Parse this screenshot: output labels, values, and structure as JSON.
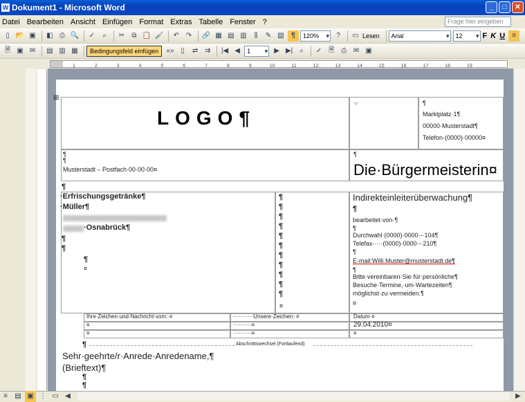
{
  "window": {
    "title": "Dokument1 - Microsoft Word",
    "help_placeholder": "Frage hier eingeben"
  },
  "menu": [
    "Datei",
    "Bearbeiten",
    "Ansicht",
    "Einfügen",
    "Format",
    "Extras",
    "Tabelle",
    "Fenster",
    "?"
  ],
  "toolbar": {
    "zoom": "120%",
    "read_label": "Lesen",
    "font": "Arial",
    "size": "12",
    "bold": "F",
    "italic": "K",
    "underline": "U",
    "insert_field_label": "Bedingungsfeld einfügen",
    "record_number": "1"
  },
  "ruler": {
    "ticks": [
      "1",
      "2",
      "3",
      "4",
      "5",
      "6",
      "7",
      "8",
      "9",
      "10",
      "11",
      "12",
      "13",
      "14",
      "15",
      "16",
      "17",
      "18",
      "19"
    ]
  },
  "letter": {
    "logo": "LOGO¶",
    "address": [
      "Marktplatz·1¶",
      "00000·Musterstadt¶",
      "Telefon·(0000)·00000¤"
    ],
    "sender_line": "Musterstadt –  Postfach·00·00·00¤",
    "authority": "Die·Bürgermeisterin¤",
    "recipient": [
      "·Erfrischungsgetränke¶",
      "·Müller¶",
      "·Osnabrück¶"
    ],
    "dept_title": "Indirekteinleiterüberwachung¶",
    "processed_by": "bearbeitet·von·¶",
    "phone_ext": "Durchwahl·(0000)·0000·-·104¶",
    "fax": "Telefax·····(0000)·0000·-·210¶",
    "email": "E-mail:Willi.Muster@musterstadt.de¶",
    "appointment": [
      "Bitte·vereinbaren·Sie·für·persönliche¶",
      "Besuche·Termine,·um·Wartezeiten¶",
      "möglichst·zu·vermeiden.¶"
    ],
    "ref_yours": "Ihre·Zeichen·und·Nachricht·vom:·¤",
    "ref_ours": "···········Unsere·Zeichen:·¤",
    "date_label": "Datum·¤",
    "date_value": "29.04.2010¤",
    "section_break": "Abschnittswechsel (Fortlaufend)",
    "salutation": "Sehr·geehrte/r·Anrede·Anredename,¶",
    "body": "(Brieftext)¶",
    "pilcrow": "¶",
    "cellmark": "¤",
    "dots": "··········¤"
  }
}
